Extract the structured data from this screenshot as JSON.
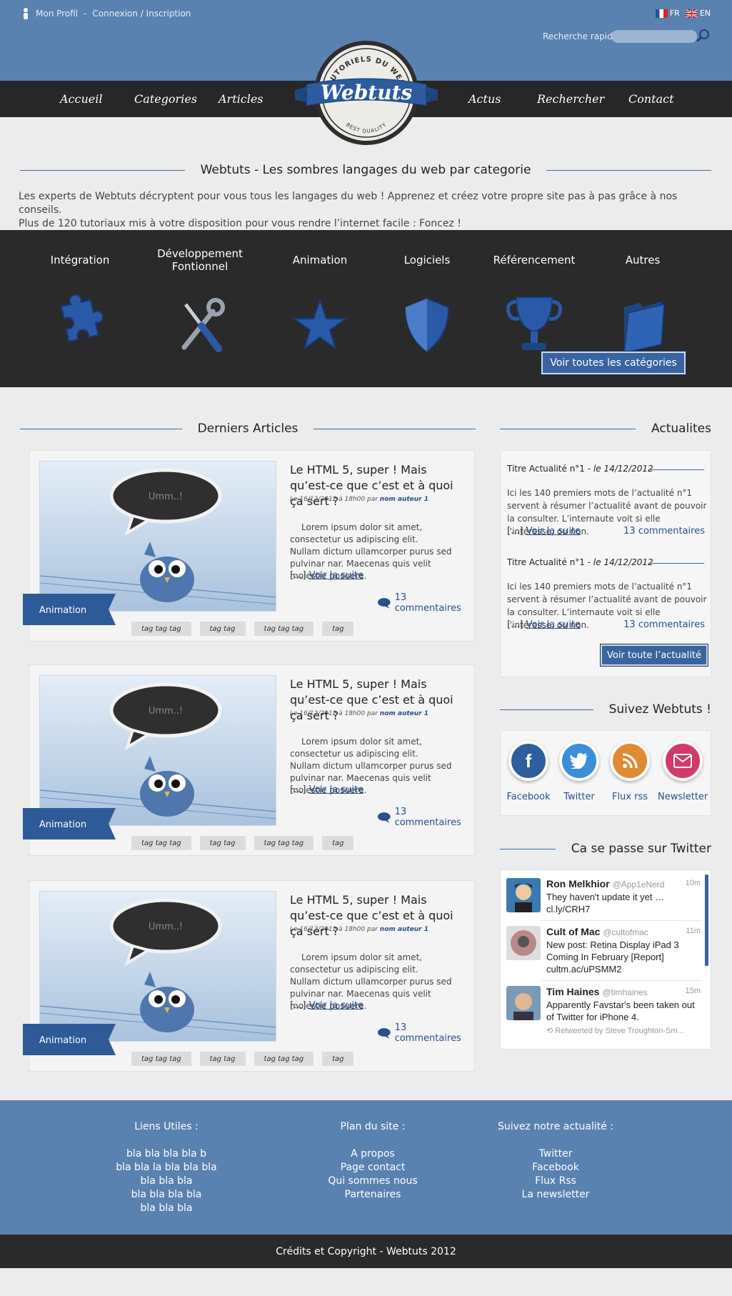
{
  "header": {
    "profile_link": "Mon Profil",
    "separator": "-",
    "login_link": "Connexion / Inscription",
    "lang_fr": "FR",
    "lang_en": "EN",
    "search_label": "Recherche rapide",
    "search_placeholder": ""
  },
  "nav": {
    "items": [
      "Accueil",
      "Categories",
      "Articles",
      "Actus",
      "Rechercher",
      "Contact"
    ]
  },
  "logo": {
    "top_text": "TUTORIELS DU WEB",
    "brand": "Webtuts",
    "bottom_text": "BEST QUALITY"
  },
  "intro": {
    "title": "Webtuts - Les sombres langages du web par categorie",
    "line1": "Les experts de Webtuts décryptent pour vous tous les langages du web ! Apprenez et créez votre propre site pas à pas grâce à nos conseils.",
    "line2": "Plus  de 120 tutoriaux mis à votre disposition pour vous rendre l’internet facile  : Foncez !"
  },
  "categories": {
    "items": [
      {
        "label": "Intégration",
        "icon": "puzzle-icon"
      },
      {
        "label": "Développement Fontionnel",
        "icon": "tools-icon"
      },
      {
        "label": "Animation",
        "icon": "star-icon"
      },
      {
        "label": "Logiciels",
        "icon": "shield-icon"
      },
      {
        "label": "Référencement",
        "icon": "trophy-icon"
      },
      {
        "label": "Autres",
        "icon": "folder-icon"
      }
    ],
    "all_button": "Voir toutes les catégories"
  },
  "articles": {
    "section_title": "Derniers Articles",
    "items": [
      {
        "title": "Le HTML 5, super ! Mais qu’est-ce que c’est et à quoi ça sert ?",
        "meta": "Le 16/12/2012 à 18h00 par ",
        "author": "nom auteur 1",
        "body1": "Lorem ipsum dolor sit amet, consectetur us adipiscing elit.",
        "body2": "Nullam dictum ullamcorper purus sed pulvinar nar. Maecenas quis velit molestie posuere.",
        "more_prefix": "[...] ",
        "more_link": "Voir la suite",
        "comments": "13 commentaires",
        "ribbon": "Animation",
        "bubble": "Umm..!",
        "tags": [
          "tag tag tag",
          "tag tag",
          "tag tag tag",
          "tag"
        ]
      },
      {
        "title": "Le HTML 5, super ! Mais qu’est-ce que c’est et à quoi ça sert ?",
        "meta": "Le 16/12/2012 à 18h00 par ",
        "author": "nom auteur 1",
        "body1": "Lorem ipsum dolor sit amet, consectetur us adipiscing elit.",
        "body2": "Nullam dictum ullamcorper purus sed pulvinar nar. Maecenas quis velit molestie posuere.",
        "more_prefix": "[...] ",
        "more_link": "Voir la suite",
        "comments": "13 commentaires",
        "ribbon": "Animation",
        "bubble": "Umm..!",
        "tags": [
          "tag tag tag",
          "tag tag",
          "tag tag tag",
          "tag"
        ]
      },
      {
        "title": "Le HTML 5, super ! Mais qu’est-ce que c’est et à quoi ça sert ?",
        "meta": "Le 16/12/2012 à 18h00 par ",
        "author": "nom auteur 1",
        "body1": "Lorem ipsum dolor sit amet, consectetur us adipiscing elit.",
        "body2": "Nullam dictum ullamcorper purus sed pulvinar nar. Maecenas quis velit molestie posuere.",
        "more_prefix": "[...] ",
        "more_link": "Voir la suite",
        "comments": "13 commentaires",
        "ribbon": "Animation",
        "bubble": "Umm..!",
        "tags": [
          "tag tag tag",
          "tag tag",
          "tag tag tag",
          "tag"
        ]
      }
    ]
  },
  "news": {
    "section_title": "Actualites",
    "items": [
      {
        "title": "Titre Actualité n°1 - ",
        "date": "le 14/12/2012",
        "body": "Ici les 140 premiers mots de l’actualité n°1 servent à résumer l’actualité avant de pouvoir la consulter. L’internaute voit si elle l’intéresse, ou non.",
        "more_prefix": "[...]  ",
        "more_link": "Voir la suite",
        "comments": "13 commentaires"
      },
      {
        "title": "Titre Actualité n°1 - ",
        "date": "le 14/12/2012",
        "body": "Ici les 140 premiers mots de l’actualité n°1 servent à résumer l’actualité avant de pouvoir la consulter. L’internaute voit si elle l’intéresse, ou non.",
        "more_prefix": "[...]  ",
        "more_link": "Voir la suite",
        "comments": "13 commentaires"
      }
    ],
    "all_button": "Voir toute l’actualité"
  },
  "follow": {
    "section_title": "Suivez Webtuts !",
    "items": [
      {
        "label": "Facebook",
        "color": "#2f5e9e"
      },
      {
        "label": "Twitter",
        "color": "#3a8fd6"
      },
      {
        "label": "Flux rss",
        "color": "#e08a33"
      },
      {
        "label": "Newsletter",
        "color": "#d23a6a"
      }
    ]
  },
  "twitter": {
    "section_title": "Ca se passe sur Twitter",
    "tweets": [
      {
        "name": "Ron Melkhior",
        "handle": "@App1eNerd",
        "time": "10m",
        "text": "They haven't update it yet … cl.ly/CRH7",
        "retweet": ""
      },
      {
        "name": "Cult of Mac",
        "handle": "@cultofmac",
        "time": "11m",
        "text": "New post: Retina Display iPad 3 Coming In February [Report] cultm.ac/uPSMM2",
        "retweet": ""
      },
      {
        "name": "Tim Haines",
        "handle": "@timhaines",
        "time": "15m",
        "text": "Apparently Favstar's been taken out of Twitter for iPhone 4.",
        "retweet": "Retweeted by Steve Troughton-Sm..."
      }
    ]
  },
  "footer": {
    "col1": {
      "title": "Liens Utiles  :",
      "links": [
        "bla bla bla bla b",
        "bla bla la bla bla bla",
        "bla bla bla",
        "bla bla bla bla",
        "bla bla bla"
      ]
    },
    "col2": {
      "title": "Plan du site :",
      "links": [
        "A propos",
        "Page contact",
        "Qui sommes nous",
        "Partenaires"
      ]
    },
    "col3": {
      "title": "Suivez notre actualité  :",
      "links": [
        "Twitter",
        "Facebook",
        "Flux Rss",
        "La newsletter"
      ]
    },
    "copyright": "Crédits et Copyright - Webtuts 2012"
  },
  "colors": {
    "header_blue": "#5a82b0",
    "dark": "#272727",
    "accent": "#3a64a0",
    "link": "#2a4f8a"
  }
}
